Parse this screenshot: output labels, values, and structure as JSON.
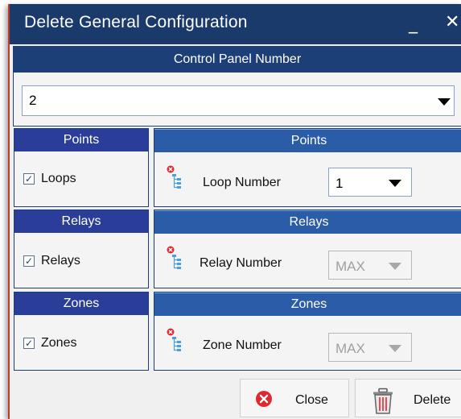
{
  "window": {
    "title": "Delete General Configuration",
    "minimize_glyph": "_",
    "close_glyph": "✕"
  },
  "control_panel": {
    "header": "Control Panel Number",
    "selected": "2"
  },
  "sections": [
    {
      "left_header": "Points",
      "checkbox_label": "Loops",
      "checked": true,
      "right_header": "Points",
      "field_label": "Loop Number",
      "value": "1",
      "enabled": true
    },
    {
      "left_header": "Relays",
      "checkbox_label": "Relays",
      "checked": true,
      "right_header": "Relays",
      "field_label": "Relay Number",
      "value": "MAX",
      "enabled": false
    },
    {
      "left_header": "Zones",
      "checkbox_label": "Zones",
      "checked": true,
      "right_header": "Zones",
      "field_label": "Zone Number",
      "value": "MAX",
      "enabled": false
    }
  ],
  "buttons": {
    "close_label": "Close",
    "delete_label": "Delete"
  },
  "icons": {
    "tree": "tree-structure-delete-icon",
    "close": "red-x-circle-icon",
    "delete": "trash-can-icon"
  },
  "colors": {
    "title_bar": "#1a3a6b",
    "header_dark": "#1d3f78",
    "header_blue": "#2b5ca7",
    "header_indigo": "#2a3d99",
    "danger": "#e0282f"
  }
}
